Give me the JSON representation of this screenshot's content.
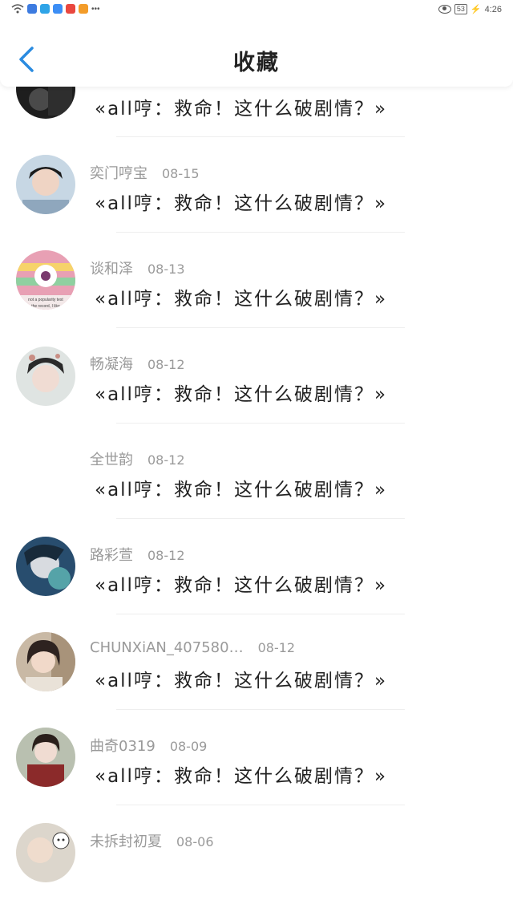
{
  "status": {
    "battery": "53",
    "time": "4:26"
  },
  "header": {
    "title": "收藏"
  },
  "items": [
    {
      "name": "",
      "date": "",
      "content": "«all哼：救命！这什么破剧情？»"
    },
    {
      "name": "奕门哼宝",
      "date": "08-15",
      "content": "«all哼：救命！这什么破剧情？»"
    },
    {
      "name": "谈和泽",
      "date": "08-13",
      "content": "«all哼：救命！这什么破剧情？»",
      "avatar_text": "not a popularity test | the record, I like"
    },
    {
      "name": "畅凝海",
      "date": "08-12",
      "content": "«all哼：救命！这什么破剧情？»"
    },
    {
      "name": "全世韵",
      "date": "08-12",
      "content": "«all哼：救命！这什么破剧情？»"
    },
    {
      "name": "路彩萱",
      "date": "08-12",
      "content": "«all哼：救命！这什么破剧情？»"
    },
    {
      "name": "CHUNXiAN_407580…",
      "date": "08-12",
      "content": "«all哼：救命！这什么破剧情？»"
    },
    {
      "name": "曲奇0319",
      "date": "08-09",
      "content": "«all哼：救命！这什么破剧情？»"
    },
    {
      "name": "未拆封初夏",
      "date": "08-06",
      "content": ""
    }
  ],
  "colors": {
    "accent": "#2a8be0",
    "name_gray": "#9a9a9a",
    "text": "#222222"
  },
  "icons": {
    "back": "chevron-left-icon",
    "eye": "eye-icon",
    "wifi": "wifi-icon"
  }
}
